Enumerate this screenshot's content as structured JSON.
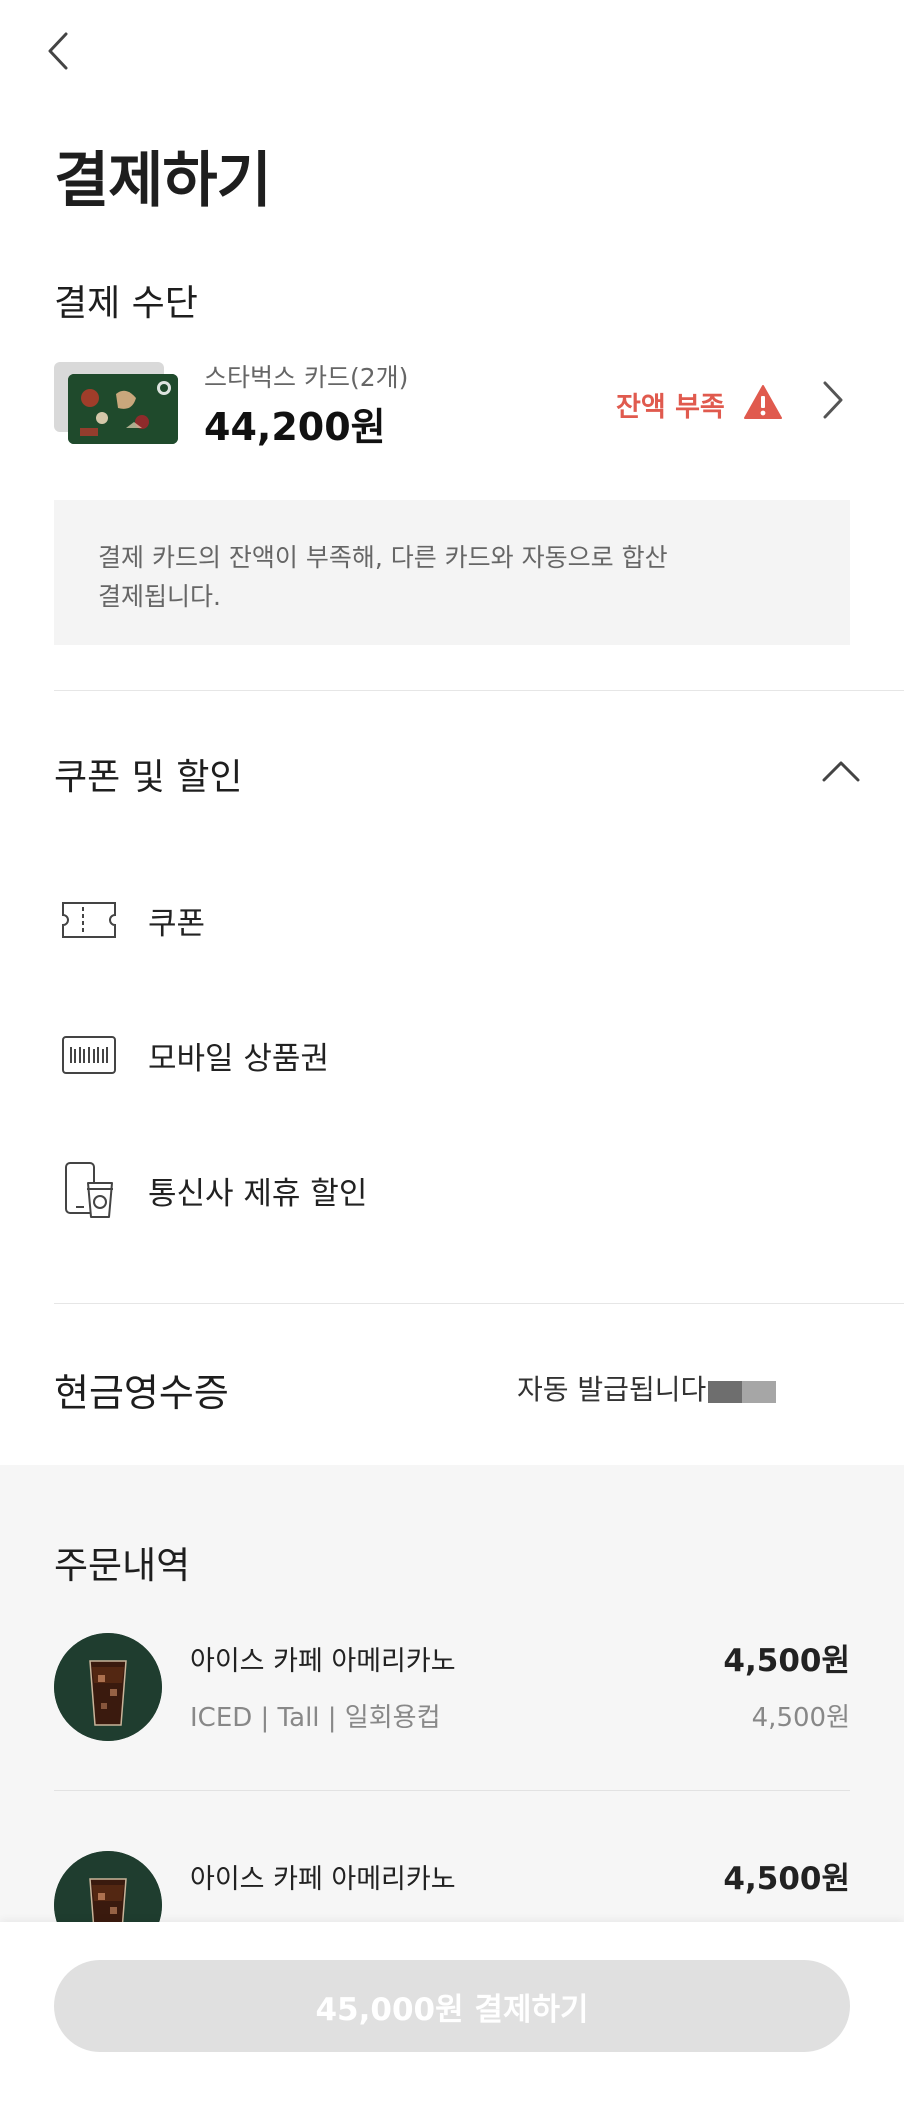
{
  "header": {
    "back_icon": "chevron-left-icon",
    "title": "결제하기"
  },
  "payment_method": {
    "heading": "결제 수단",
    "card_name": "스타벅스 카드(2개)",
    "card_balance": "44,200원",
    "warning_text": "잔액 부족",
    "warning_icon": "warning-triangle-icon",
    "warning_color": "#e05a4e",
    "notice_lines": [
      "결제 카드의 잔액이 부족해, 다른 카드와 자동으로 합산",
      "결제됩니다."
    ]
  },
  "coupons": {
    "heading": "쿠폰 및 할인",
    "collapse_icon": "chevron-up-icon",
    "items": [
      {
        "label": "쿠폰",
        "icon": "ticket-icon"
      },
      {
        "label": "모바일 상품권",
        "icon": "barcode-icon"
      },
      {
        "label": "통신사 제휴 할인",
        "icon": "phone-cup-icon"
      }
    ]
  },
  "cash_receipt": {
    "label": "현금영수증",
    "status": "자동 발급됩니다"
  },
  "order": {
    "heading": "주문내역",
    "items": [
      {
        "name": "아이스 카페 아메리카노",
        "price": "4,500원",
        "options": "ICED | Tall | 일회용컵",
        "unit_price": "4,500원"
      },
      {
        "name": "아이스 카페 아메리카노",
        "price": "4,500원",
        "options": "",
        "unit_price": ""
      }
    ]
  },
  "footer": {
    "pay_button_label": "45,000원 결제하기"
  },
  "colors": {
    "brand_green": "#1f4a2c",
    "disabled_button": "#e0e0e0",
    "warning": "#e05a4e"
  }
}
